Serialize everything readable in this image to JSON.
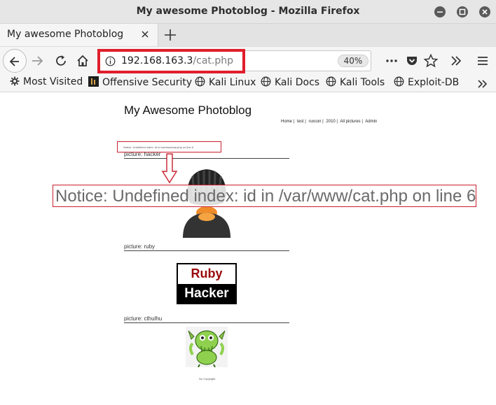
{
  "window": {
    "title": "My awesome Photoblog - Mozilla Firefox"
  },
  "tab": {
    "label": "My awesome Photoblog"
  },
  "url": {
    "host": "192.168.163.3",
    "path": "/cat.php",
    "zoom": "40%"
  },
  "bookmarks": [
    {
      "label": "Most Visited",
      "icon": "gear-icon"
    },
    {
      "label": "Offensive Security",
      "icon": "offsec-icon"
    },
    {
      "label": "Kali Linux",
      "icon": "globe-icon"
    },
    {
      "label": "Kali Docs",
      "icon": "globe-icon"
    },
    {
      "label": "Kali Tools",
      "icon": "globe-icon"
    },
    {
      "label": "Exploit-DB",
      "icon": "globe-icon"
    }
  ],
  "site": {
    "title": "My Awesome Photoblog",
    "nav": [
      "Home |",
      "test |",
      "ruxcon |",
      "2010 |",
      "All pictures |",
      "Admin"
    ],
    "small_notice": "Notice: Undefined index: id in /var/www/cat.php on line 6",
    "big_notice": "Notice: Undefined index: id in /var/www/cat.php on line 6",
    "pictures": [
      {
        "title": "picture: hacker"
      },
      {
        "title": "picture: ruby"
      },
      {
        "title": "picture: cthulhu"
      }
    ],
    "ruby_logo_top": "Ruby",
    "ruby_logo_bottom": "Hacker",
    "footer": "No Copyright"
  },
  "colors": {
    "highlight": "#e01e2b"
  }
}
